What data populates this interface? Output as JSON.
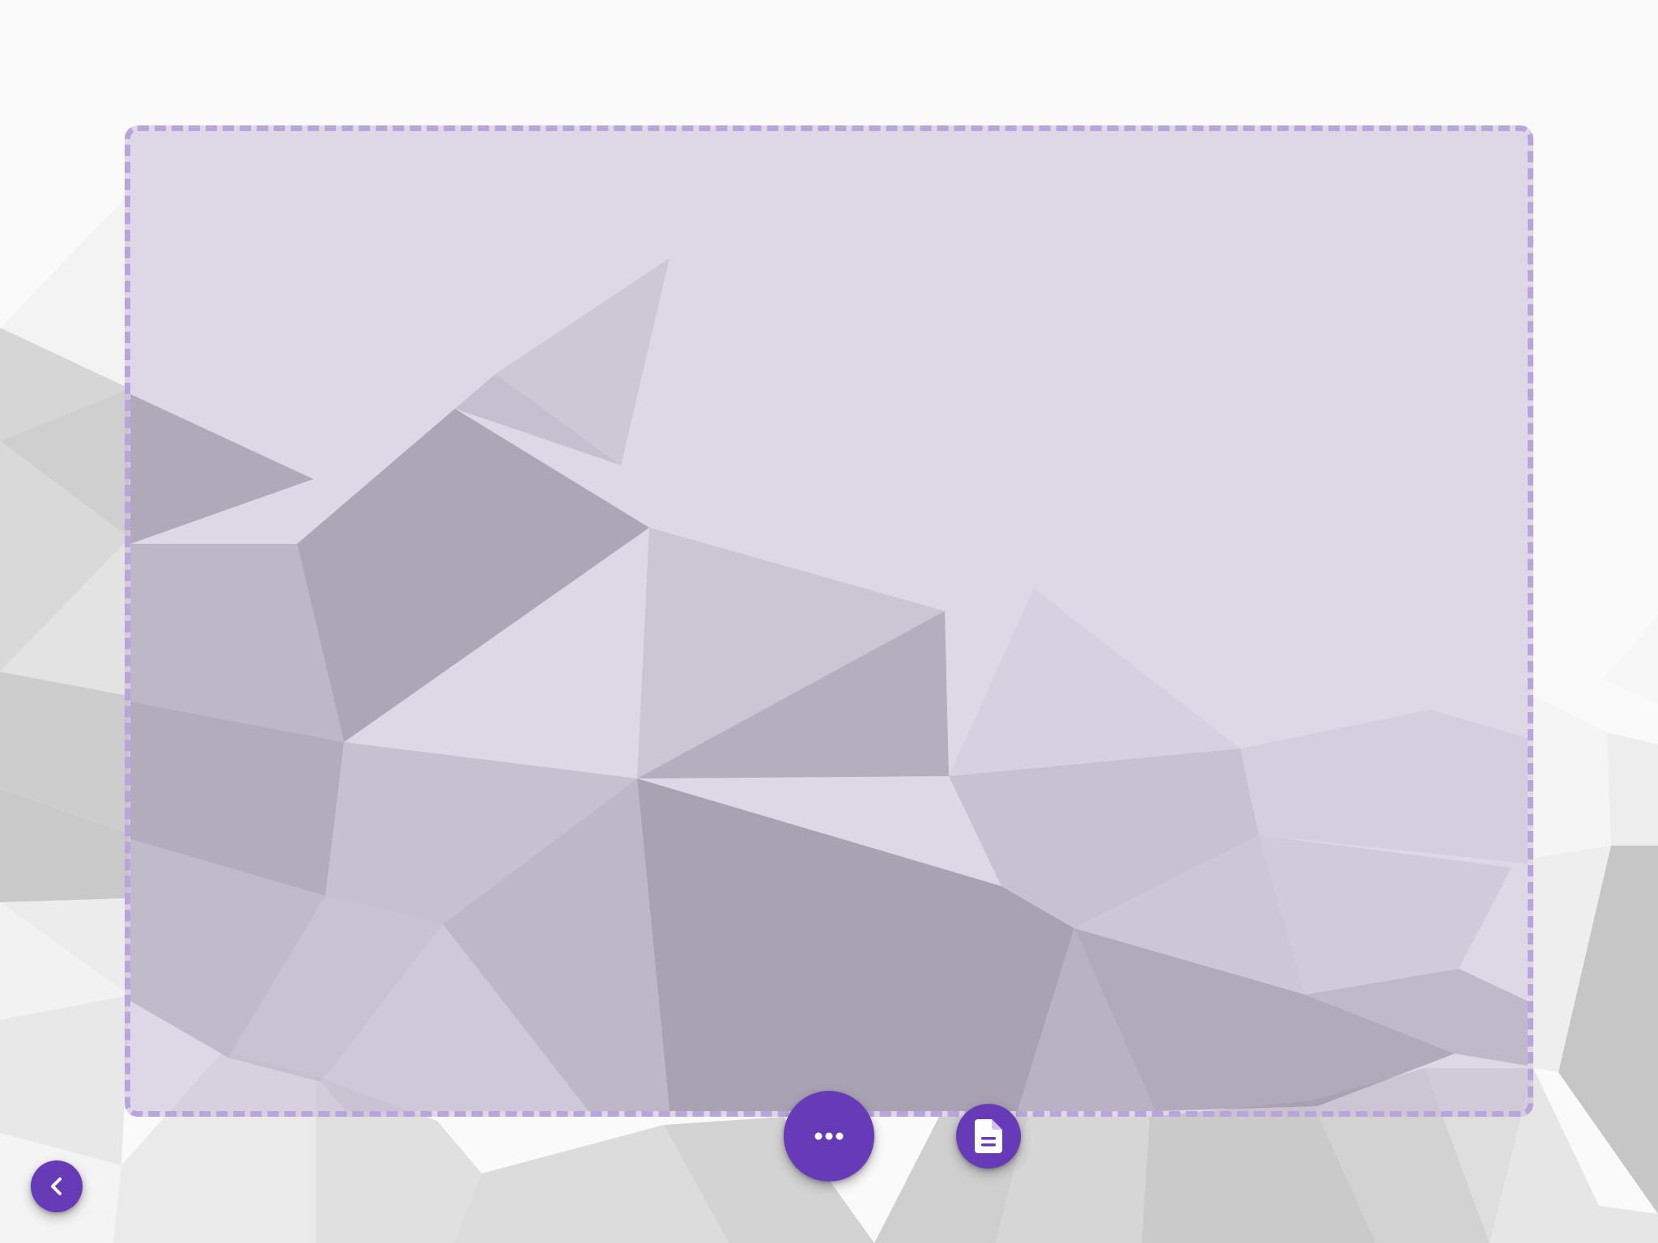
{
  "app": {
    "drop_zone_hint": ""
  },
  "controls": {
    "more_button_icon": "more-horiz-icon",
    "document_button_icon": "document-icon",
    "back_button_icon": "chevron-left-icon"
  },
  "colors": {
    "accent": "#673ab7",
    "drop_zone_border": "#b9a4dc",
    "drop_zone_fill": "#c4bad6"
  }
}
